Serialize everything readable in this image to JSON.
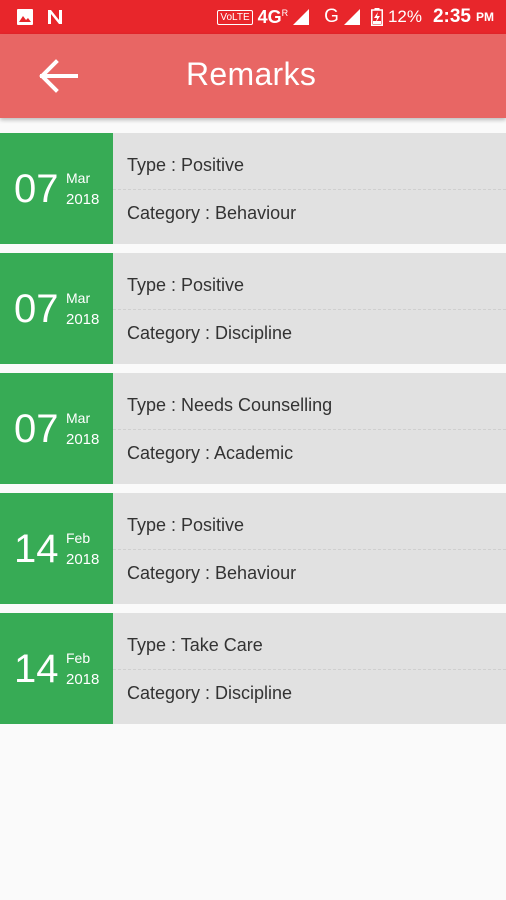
{
  "status_bar": {
    "time": "2:35",
    "ampm": "PM",
    "battery": "12%",
    "volte": "VoLTE",
    "network": "4G",
    "network_r": "R",
    "network2": "G"
  },
  "app_bar": {
    "title": "Remarks",
    "back_icon": "arrow-back-icon"
  },
  "remarks": [
    {
      "day": "07",
      "month": "Mar",
      "year": "2018",
      "type": "Type : Positive",
      "category": "Category : Behaviour"
    },
    {
      "day": "07",
      "month": "Mar",
      "year": "2018",
      "type": "Type : Positive",
      "category": "Category : Discipline"
    },
    {
      "day": "07",
      "month": "Mar",
      "year": "2018",
      "type": "Type : Needs Counselling",
      "category": "Category : Academic"
    },
    {
      "day": "14",
      "month": "Feb",
      "year": "2018",
      "type": "Type : Positive",
      "category": "Category : Behaviour"
    },
    {
      "day": "14",
      "month": "Feb",
      "year": "2018",
      "type": "Type : Take Care",
      "category": "Category : Discipline"
    }
  ],
  "colors": {
    "status_bar": "#e8262b",
    "app_bar": "#e86664",
    "date_box": "#37ab55",
    "card": "#e1e1e1",
    "background": "#fafafa"
  }
}
